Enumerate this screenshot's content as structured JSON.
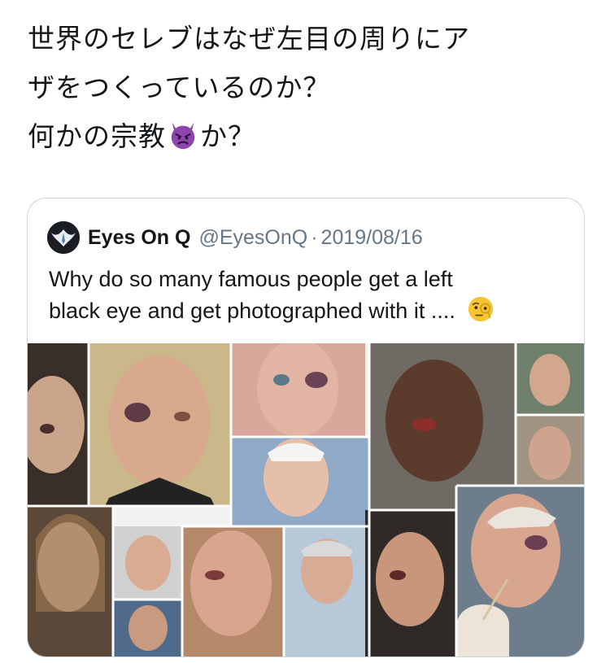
{
  "tweet": {
    "lines": [
      "世界のセレブはなぜ左目の周りにア",
      "ザをつくっているのか？",
      "何かの宗教",
      "か？"
    ],
    "emoji": "smiling-face-with-horns-icon"
  },
  "quoted_tweet": {
    "author_name": "Eyes On Q",
    "handle": "@EyesOnQ",
    "separator": "·",
    "date": "2019/08/16",
    "text_lines": [
      "Why do so many famous people get a left",
      "black eye and get photographed with it ...."
    ],
    "emoji": "face-with-monocle-icon"
  },
  "collage": {
    "photo_count": 15,
    "description_visible": false
  },
  "colors": {
    "text": "#14171a",
    "secondary_text": "#657786",
    "card_border": "#ccd6dd",
    "devil_purple": "#8e44ad",
    "monocle_yellow": "#f7c531"
  }
}
